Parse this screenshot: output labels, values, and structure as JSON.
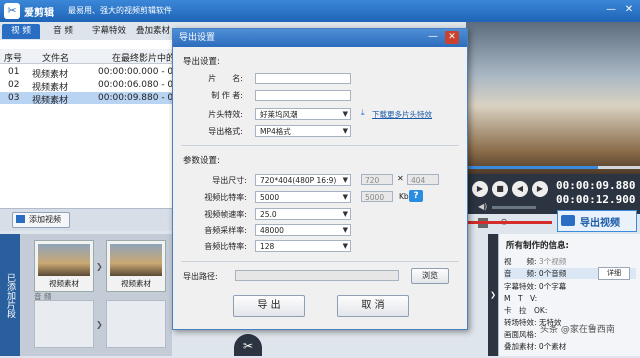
{
  "app": {
    "name": "爱剪辑",
    "slogan": "最易用、强大的视频剪辑软件",
    "logo_icon": "scissors-logo-icon"
  },
  "tabs": [
    "视 频",
    "音 频",
    "字幕特效",
    "叠加素材"
  ],
  "active_tab": 0,
  "file_list": {
    "headers": [
      "序号",
      "文件名",
      "在最终影片中的"
    ],
    "rows": [
      {
        "index": "01",
        "name": "视频素材",
        "range": "00:00:00.000 - 0"
      },
      {
        "index": "02",
        "name": "视频素材",
        "range": "00:00:06.080 - 0"
      },
      {
        "index": "03",
        "name": "视频素材",
        "range": "00:00:09.880 - 0"
      }
    ],
    "selected_row": 2
  },
  "add_video_label": "添加视频",
  "timeline": {
    "side_label": "已添加片段",
    "clips": [
      "视频素材",
      "视频素材"
    ],
    "audio_label": "音 频"
  },
  "player": {
    "current_time": "00:00:09.880",
    "total_time": "00:00:12.900"
  },
  "export_button": "导出视频",
  "info_panel": {
    "title": "所有制作的信息:",
    "rows": [
      {
        "label": "视　　频:",
        "value": "3个视频"
      },
      {
        "label": "音　　频:",
        "value": "0个音频"
      },
      {
        "label": "字幕特效:",
        "value": "0个字幕"
      },
      {
        "label": "M　T　V:",
        "value": ""
      },
      {
        "label": "卡　拉　OK:",
        "value": ""
      },
      {
        "label": "转场特效:",
        "value": "无特效"
      },
      {
        "label": "画面风格:",
        "value": ""
      },
      {
        "label": "叠加素材:",
        "value": "0个素材"
      }
    ],
    "detail_button": "详细"
  },
  "dialog": {
    "title": "导出设置",
    "close_icon": "close-icon",
    "export_section": "导出设置:",
    "fields": {
      "piece_name_label": "片　　名:",
      "producer_label": "制 作 者:",
      "intro_label": "片头特效:",
      "intro_value": "好莱坞风潮",
      "download_link": "下载更多片头特效",
      "format_label": "导出格式:",
      "format_value": "MP4格式"
    },
    "params_section": "参数设置:",
    "params": {
      "size_label": "导出尺寸:",
      "size_value": "720*404(480P 16:9)",
      "width": "720",
      "height": "404",
      "bitrate_label": "视频比特率:",
      "bitrate_value": "5000",
      "bitrate_box": "5000",
      "bitrate_unit": "Kbps",
      "help": "?",
      "fps_label": "视频帧速率:",
      "fps_value": "25.0",
      "sample_label": "音频采样率:",
      "sample_value": "48000",
      "abitrate_label": "音频比特率:",
      "abitrate_value": "128"
    },
    "path_label": "导出路径:",
    "path_value": "",
    "browse_button": "浏览",
    "export_button": "导 出",
    "cancel_button": "取 消"
  },
  "watermark": "头条 @家在鲁西南",
  "colors": {
    "accent": "#2a6ec4",
    "arrow": "#d42b2b"
  }
}
